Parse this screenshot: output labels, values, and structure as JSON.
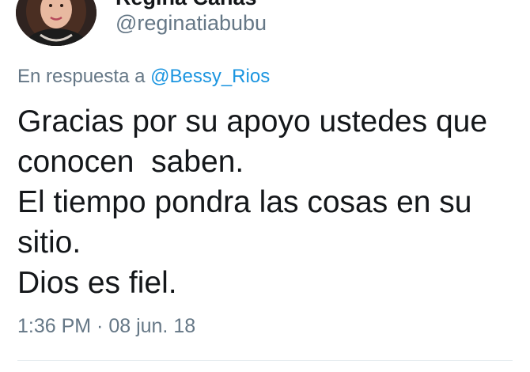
{
  "author": {
    "display_name": "Regina Cañas",
    "handle": "@reginatiabubu"
  },
  "reply": {
    "prefix": "En respuesta a ",
    "mention": "@Bessy_Rios"
  },
  "tweet": {
    "lines": [
      "Gracias por su apoyo ustedes que",
      "conocen  saben.",
      "El tiempo pondra las cosas en su",
      "sitio.",
      "Dios es fiel."
    ]
  },
  "meta": {
    "timestamp": "1:36 PM · 08 jun. 18"
  },
  "colors": {
    "link": "#1b95e0",
    "muted": "#657786",
    "text": "#14171a"
  }
}
